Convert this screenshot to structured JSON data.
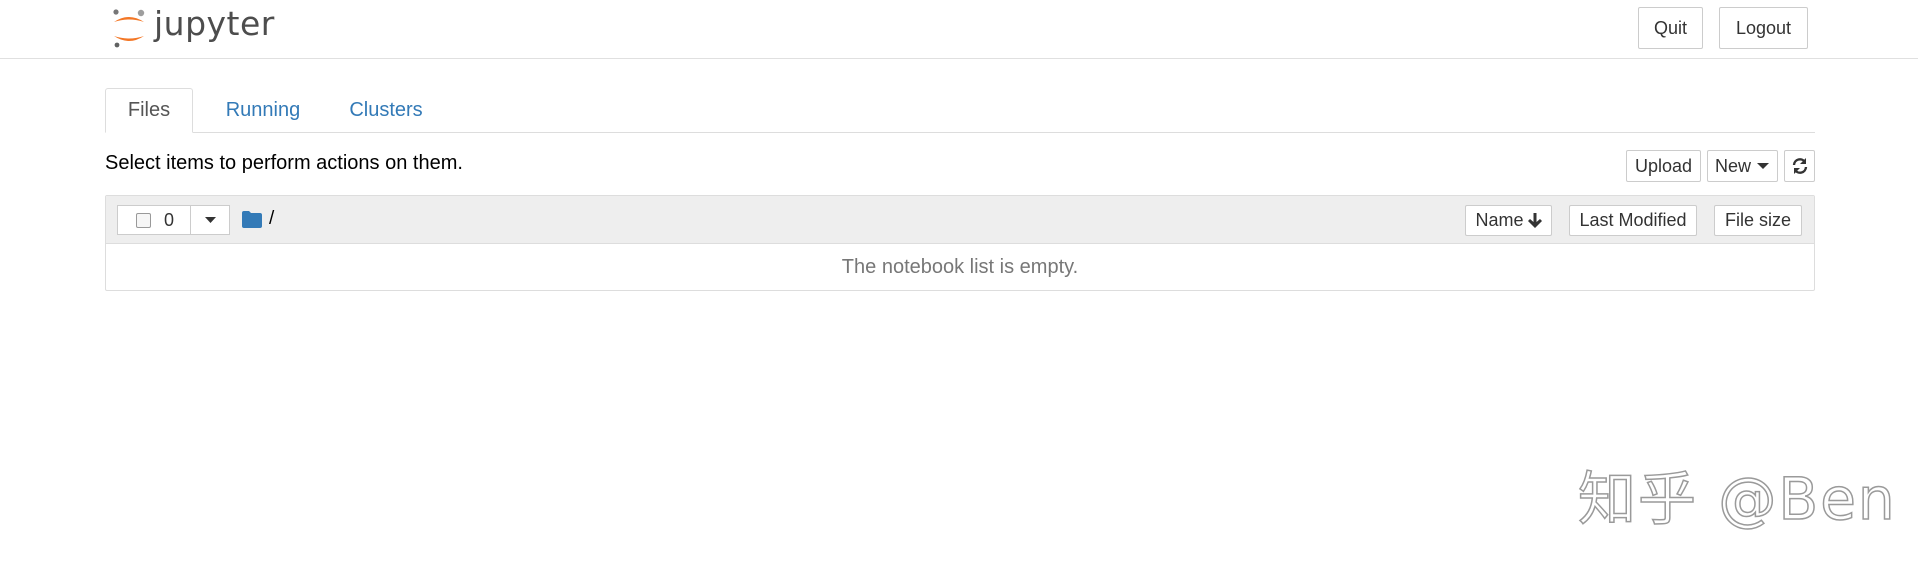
{
  "header": {
    "logo_text": "jupyter",
    "quit_label": "Quit",
    "logout_label": "Logout"
  },
  "tabs": [
    {
      "label": "Files",
      "active": true
    },
    {
      "label": "Running",
      "active": false
    },
    {
      "label": "Clusters",
      "active": false
    }
  ],
  "toolbar": {
    "instruction": "Select items to perform actions on them.",
    "upload_label": "Upload",
    "new_label": "New",
    "refresh_icon": "refresh-icon"
  },
  "file_list": {
    "selected_count": "0",
    "breadcrumb_path": "/",
    "sort_name_label": "Name",
    "sort_modified_label": "Last Modified",
    "sort_size_label": "File size",
    "empty_message": "The notebook list is empty."
  },
  "watermark": "知乎 @Ben",
  "colors": {
    "link": "#337ab7",
    "logo_orange": "#f37726",
    "folder_blue": "#337ab7"
  }
}
